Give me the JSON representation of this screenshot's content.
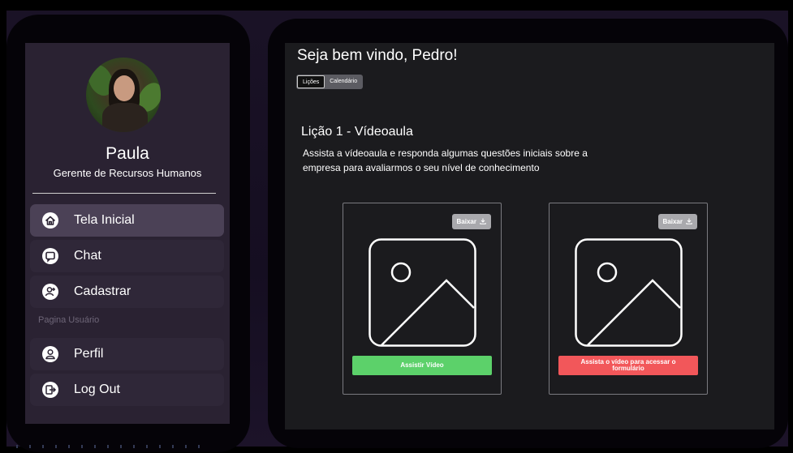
{
  "profile": {
    "name": "Paula",
    "role": "Gerente de Recursos Humanos",
    "avatar_icon": "user-photo"
  },
  "sidebar": {
    "items": [
      {
        "label": "Tela Inicial",
        "icon": "home-icon",
        "active": true
      },
      {
        "label": "Chat",
        "icon": "chat-icon",
        "active": false
      },
      {
        "label": "Cadastrar",
        "icon": "add-user-icon",
        "active": false
      }
    ],
    "section_label": "Pagina Usuário",
    "user_items": [
      {
        "label": "Perfil",
        "icon": "profile-icon"
      },
      {
        "label": "Log Out",
        "icon": "logout-icon"
      }
    ]
  },
  "main": {
    "welcome": "Seja bem vindo, Pedro!",
    "tabs": [
      {
        "label": "Lições",
        "active": true
      },
      {
        "label": "Calendário",
        "active": false
      }
    ],
    "lesson": {
      "title": "Lição 1 - Vídeoaula",
      "description": "Assista a vídeoaula e responda algumas questões iniciais sobre a empresa para avaliarmos o seu nível de conhecimento"
    },
    "cards": [
      {
        "download_label": "Baixar",
        "action_label": "Assistir Vídeo",
        "action_color": "#5cd16a"
      },
      {
        "download_label": "Baixar",
        "action_label": "Assista o vídeo para acessar o formulário",
        "action_color": "#f2575a"
      }
    ]
  },
  "colors": {
    "sidebar_bg": "#2a2232",
    "active_item": "#4b4156",
    "main_bg": "#1b1b1e",
    "accent_green": "#5cd16a",
    "accent_red": "#f2575a"
  }
}
